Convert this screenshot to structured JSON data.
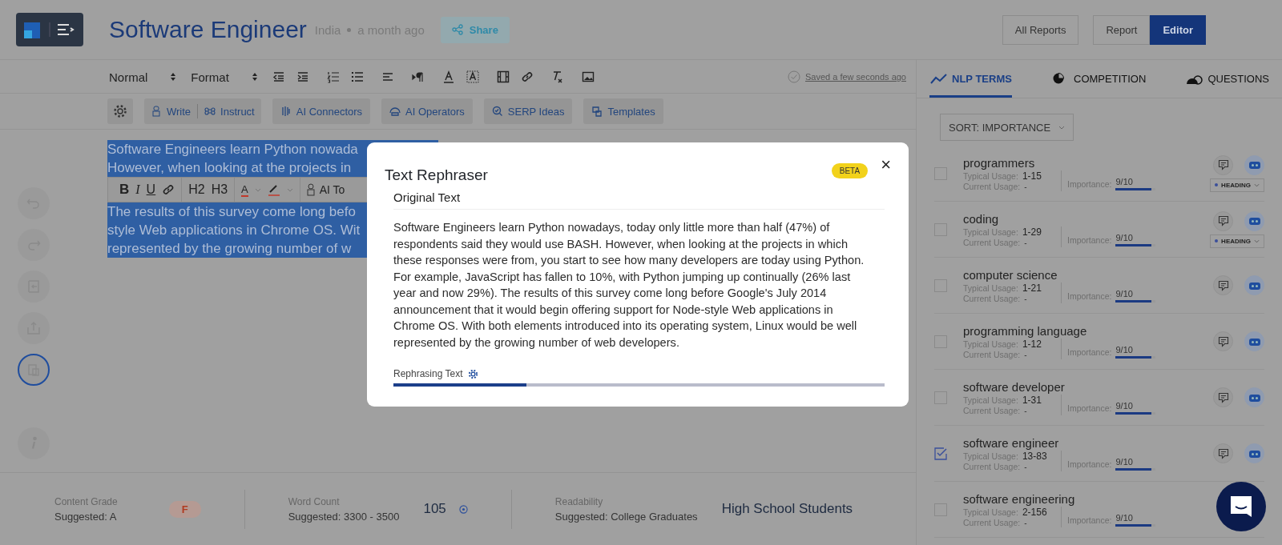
{
  "header": {
    "title": "Software Engineer",
    "location": "India",
    "time": "a month ago",
    "share": "Share",
    "buttons": [
      {
        "label": "All Reports",
        "selected": false
      },
      {
        "label": "Report",
        "selected": false
      },
      {
        "label": "Editor",
        "selected": true
      }
    ]
  },
  "toolbar": {
    "style_select": "Normal",
    "format_select": "Format",
    "saved": "Saved a few seconds ago"
  },
  "ai_toolbar": [
    "Write",
    "Instruct",
    "AI Connectors",
    "AI Operators",
    "SERP Ideas",
    "Templates"
  ],
  "rail": [
    {
      "selected": false
    },
    {
      "selected": false
    },
    {
      "selected": false
    },
    {
      "selected": false
    },
    {
      "selected": true
    },
    {
      "selected": false
    }
  ],
  "editor": {
    "lines": [
      "Software Engineers learn Python nowada",
      "However, when looking at the projects in",
      "The results of this survey come long befo",
      "style Web applications in Chrome OS. Wit",
      "represented by the growing number of w"
    ],
    "floating_toolbar": {
      "bold": "B",
      "italic": "I",
      "underline": "U",
      "h2": "H2",
      "h3": "H3",
      "text_color": "A",
      "ai": "AI To"
    }
  },
  "footer": [
    {
      "label": "Content Grade",
      "suggested": "Suggested: A",
      "value": "F",
      "kind": "grade"
    },
    {
      "label": "Word Count",
      "suggested": "Suggested: 3300 - 3500",
      "value": "105",
      "kind": "count"
    },
    {
      "label": "Readability",
      "suggested": "Suggested: College Graduates",
      "value": "High School Students",
      "kind": "text"
    }
  ],
  "panel": {
    "tabs": [
      {
        "label": "NLP TERMS",
        "selected": true
      },
      {
        "label": "COMPETITION",
        "selected": false
      },
      {
        "label": "QUESTIONS",
        "selected": false
      }
    ],
    "sort": "SORT: IMPORTANCE",
    "terms": [
      {
        "name": "programmers",
        "typical_label": "Typical Usage:",
        "typical": "1-15",
        "current_label": "Current Usage:",
        "current": "-",
        "importance_label": "Importance:",
        "importance": "9/10",
        "level": 0.9,
        "checked": false,
        "heading": "HEADING"
      },
      {
        "name": "coding",
        "typical_label": "Typical Usage:",
        "typical": "1-29",
        "current_label": "Current Usage:",
        "current": "-",
        "importance_label": "Importance:",
        "importance": "9/10",
        "level": 0.9,
        "checked": false,
        "heading": "HEADING"
      },
      {
        "name": "computer science",
        "typical_label": "Typical Usage:",
        "typical": "1-21",
        "current_label": "Current Usage:",
        "current": "-",
        "importance_label": "Importance:",
        "importance": "9/10",
        "level": 0.9,
        "checked": false
      },
      {
        "name": "programming language",
        "typical_label": "Typical Usage:",
        "typical": "1-12",
        "current_label": "Current Usage:",
        "current": "-",
        "importance_label": "Importance:",
        "importance": "9/10",
        "level": 0.9,
        "checked": false
      },
      {
        "name": "software developer",
        "typical_label": "Typical Usage:",
        "typical": "1-31",
        "current_label": "Current Usage:",
        "current": "-",
        "importance_label": "Importance:",
        "importance": "9/10",
        "level": 0.9,
        "checked": false
      },
      {
        "name": "software engineer",
        "typical_label": "Typical Usage:",
        "typical": "13-83",
        "current_label": "Current Usage:",
        "current": "-",
        "importance_label": "Importance:",
        "importance": "9/10",
        "level": 0.9,
        "checked": true
      },
      {
        "name": "software engineering",
        "typical_label": "Typical Usage:",
        "typical": "2-156",
        "current_label": "Current Usage:",
        "current": "-",
        "importance_label": "Importance:",
        "importance": "9/10",
        "level": 0.9,
        "checked": false
      }
    ]
  },
  "modal": {
    "title": "Text Rephraser",
    "badge": "BETA",
    "close": "×",
    "section": "Original Text",
    "text": "Software Engineers learn Python nowadays, today only little more than half (47%) of respondents said they would use BASH. However, when looking at the projects in which these responses were from, you start to see how many developers are today using Python. For example, JavaScript has fallen to 10%, with Python jumping up continually (26% last year and now 29%). The results of this survey come long before Google's July 2014 announcement that it would begin offering support for Node-style Web applications in Chrome OS. With both elements introduced into its operating system, Linux would be well represented by the growing number of web developers.",
    "status": "Rephrasing Text",
    "level": 0.27
  }
}
